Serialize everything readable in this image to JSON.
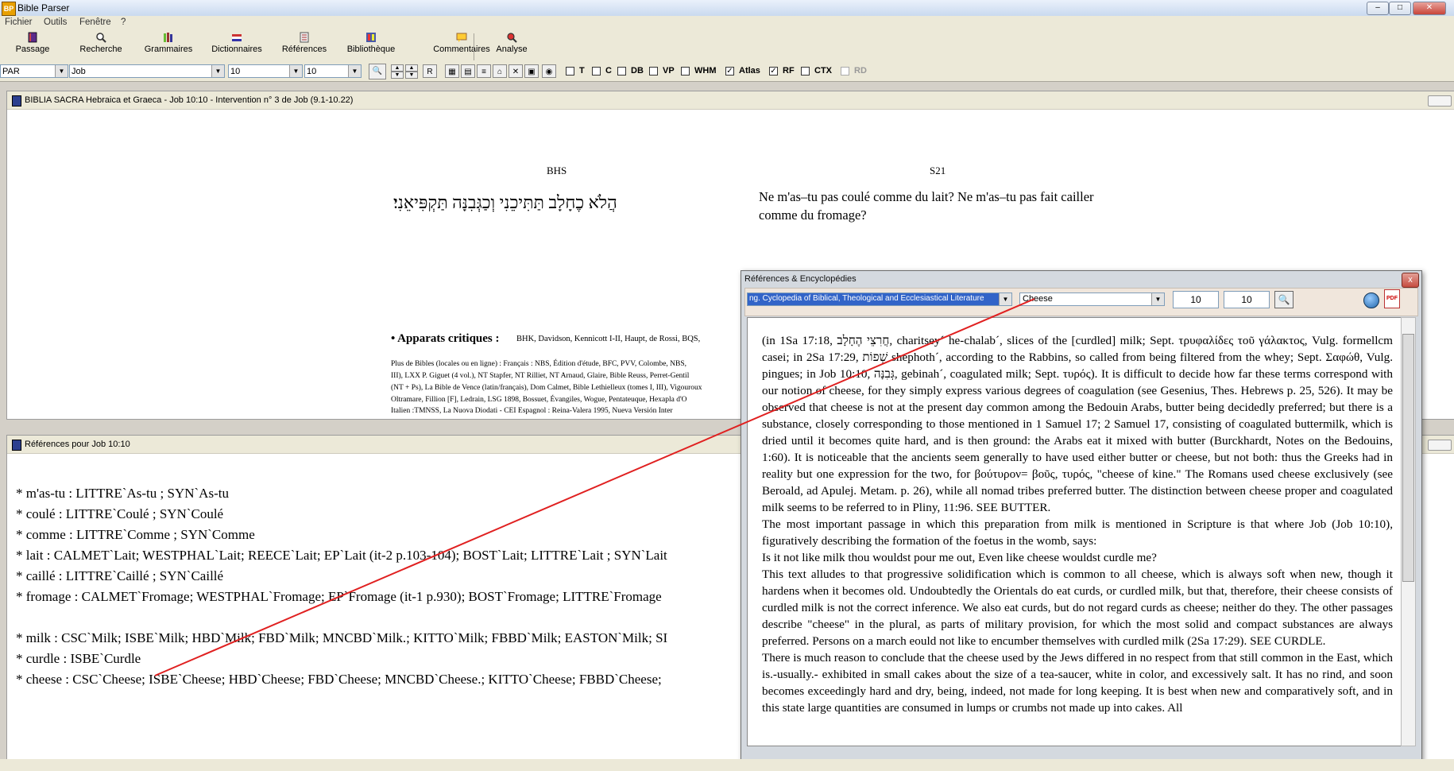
{
  "app": {
    "title": "Bible Parser",
    "icon_text": "BP"
  },
  "menu": [
    "Fichier",
    "Outils",
    "Fenêtre",
    "?"
  ],
  "toolbar": {
    "buttons": [
      {
        "label": "Passage",
        "icon": "book-icon"
      },
      {
        "label": "Recherche",
        "icon": "search-icon"
      },
      {
        "label": "Grammaires",
        "icon": "books-icon"
      },
      {
        "label": "Dictionnaires",
        "icon": "flag-icon"
      },
      {
        "label": "Références",
        "icon": "document-icon"
      },
      {
        "label": "Bibliothèque",
        "icon": "library-icon"
      },
      {
        "label": "Commentaires",
        "icon": "comments-icon"
      },
      {
        "label": "Analyse",
        "icon": "analysis-icon"
      }
    ]
  },
  "toolbar2": {
    "version_select": "PAR",
    "book_select": "Job",
    "chapter_select": "10",
    "verse_select": "10",
    "r_button": "R",
    "checkboxes": [
      {
        "label": "T",
        "checked": false
      },
      {
        "label": "C",
        "checked": false
      },
      {
        "label": "DB",
        "checked": false
      },
      {
        "label": "VP",
        "checked": false
      },
      {
        "label": "WHM",
        "checked": false
      },
      {
        "label": "Atlas",
        "checked": true
      },
      {
        "label": "RF",
        "checked": true
      },
      {
        "label": "CTX",
        "checked": false
      },
      {
        "label": "RD",
        "checked": false
      }
    ]
  },
  "main_window": {
    "title": "BIBLIA SACRA Hebraica et Graeca - Job 10:10 - Intervention n° 3 de Job (9.1-10.22)",
    "col1_header": "BHS",
    "col2_header": "S21",
    "hebrew": "הֲלֹא כֶחָלָב תַּתִּיכֵנִי וְכַגְּבִנָּה תַּקְפִּיאֵנִי׃",
    "french": "Ne m'as–tu pas coulé comme du lait? Ne m'as–tu pas fait cailler comme du fromage?",
    "apparat_title": "• Apparats critiques :",
    "apparat_text": "BHK, Davidson, Kennicott I-II, Haupt, de Rossi, BQS,",
    "lines": [
      "Plus de Bibles (locales ou en ligne) : Français : NBS, Édition d'étude, BFC, PVV, Colombe, NBS,",
      "III), LXX P. Giguet (4 vol.), NT Stapfer, NT Rilliet, NT Arnaud, Glaire, Bible Reuss, Perret-Gentil",
      "(NT + Ps), La Bible de Vence (latin/français), Dom Calmet, Bible Lethielleux (tomes I, III), Vigouroux",
      "Oltramare, Fillion [F], Ledrain, LSG 1898, Bossuet, Évangiles, Wogue, Pentateuque, Hexapla d'O",
      "Italien :TMNSS, La Nuova Diodati - CEI Espagnol : Reina-Valera 1995, Nueva Versión Inter"
    ]
  },
  "refs_window": {
    "title": "Références pour Job 10:10",
    "lines": [
      "* m'as-tu : LITTRE`As-tu ; SYN`As-tu",
      "* coulé : LITTRE`Coulé ; SYN`Coulé",
      "* comme : LITTRE`Comme ; SYN`Comme",
      "* lait : CALMET`Lait; WESTPHAL`Lait; REECE`Lait; EP`Lait (it-2 p.103-104); BOST`Lait; LITTRE`Lait ; SYN`Lait",
      "* caillé : LITTRE`Caillé ; SYN`Caillé",
      "* fromage : CALMET`Fromage; WESTPHAL`Fromage; EP`Fromage (it-1 p.930); BOST`Fromage; LITTRE`Fromage",
      "*  milk  : CSC`Milk; ISBE`Milk; HBD`Milk; FBD`Milk; MNCBD`Milk.; KITTO`Milk; FBBD`Milk; EASTON`Milk; SI",
      "*  curdle  : ISBE`Curdle",
      "*  cheese  : CSC`Cheese; ISBE`Cheese; HBD`Cheese; FBD`Cheese; MNCBD`Cheese.; KITTO`Cheese; FBBD`Cheese;"
    ]
  },
  "dialog": {
    "title": "Références & Encyclopédies",
    "close": "x",
    "source_select": "ng. Cyclopedia of Biblical, Theological and Ecclesiastical Literature",
    "term_select": "Cheese",
    "num1": "10",
    "num2": "10",
    "text": [
      "(in 1Sa 17:18, חֲרִצֵי הֶחָלָב, charitsey´ he-chalab´, slices of the [curdled] milk; Sept. τρυφαλίδες τοῦ γάλακτος, Vulg. formellcm casei; in 2Sa 17:29, שְׁפוֹת shephoth´, according to the Rabbins, so called from being filtered from the whey; Sept. Σαφώθ, Vulg. pingues; in Job 10:10, גְּבִנָּה, gebinah´, coagulated milk; Sept. τυρός). It is difficult to decide how far these terms correspond with our notion of cheese, for they simply express various degrees of coagulation (see Gesenius, Thes. Hebrews p. 25, 526). It may be observed that cheese is not at the present day common among the Bedouin Arabs, butter being decidedly preferred; but there is a substance, closely corresponding to those mentioned in 1 Samuel 17; 2 Samuel 17, consisting of coagulated buttermilk, which is dried until it becomes quite hard, and is then ground: the Arabs eat it mixed with butter (Burckhardt, Notes on the Bedouins, 1:60). It is noticeable that the ancients seem generally to have used either butter or cheese, but not both: thus the Greeks had in reality but one expression for the two, for βούτυρον= βοῦς, τυρός, \"cheese of kine.\" The Romans used cheese exclusively (see Beroald, ad Apulej. Metam. p. 26), while all nomad tribes preferred butter. The distinction between cheese proper and coagulated milk seems to be referred to in Pliny, 11:96. SEE BUTTER.",
      "The most important passage in which this preparation from milk is mentioned in Scripture is that where Job (Job 10:10), figuratively describing the formation of the foetus in the womb, says:",
      "Is it not like milk thou wouldst pour me out, Even like cheese wouldst curdle me?",
      "This text alludes to that progressive solidification which is common to all cheese, which is always soft when new, though it hardens when it becomes old. Undoubtedly the Orientals do eat curds, or curdled milk, but that, therefore, their cheese consists of curdled milk is not the correct inference. We also eat curds, but do not regard curds as cheese; neither do they. The other passages describe \"cheese\" in the plural, as parts of military provision, for which the most solid and compact substances are always preferred. Persons on a march eould not like to encumber themselves with curdled milk (2Sa 17:29). SEE CURDLE.",
      "There is much reason to conclude that the cheese used by the Jews differed in no respect from that still common in the East, which is.-usually.- exhibited in small cakes about the size of a tea-saucer, white in color, and excessively salt. It has no rind, and soon becomes exceedingly hard and dry, being, indeed, not made for long keeping. It is best when new and comparatively soft, and in this state large quantities are consumed in lumps or crumbs not made up into cakes. All"
    ]
  },
  "colors": {
    "annotation_line": "#e02020",
    "selection": "#3264c8"
  }
}
